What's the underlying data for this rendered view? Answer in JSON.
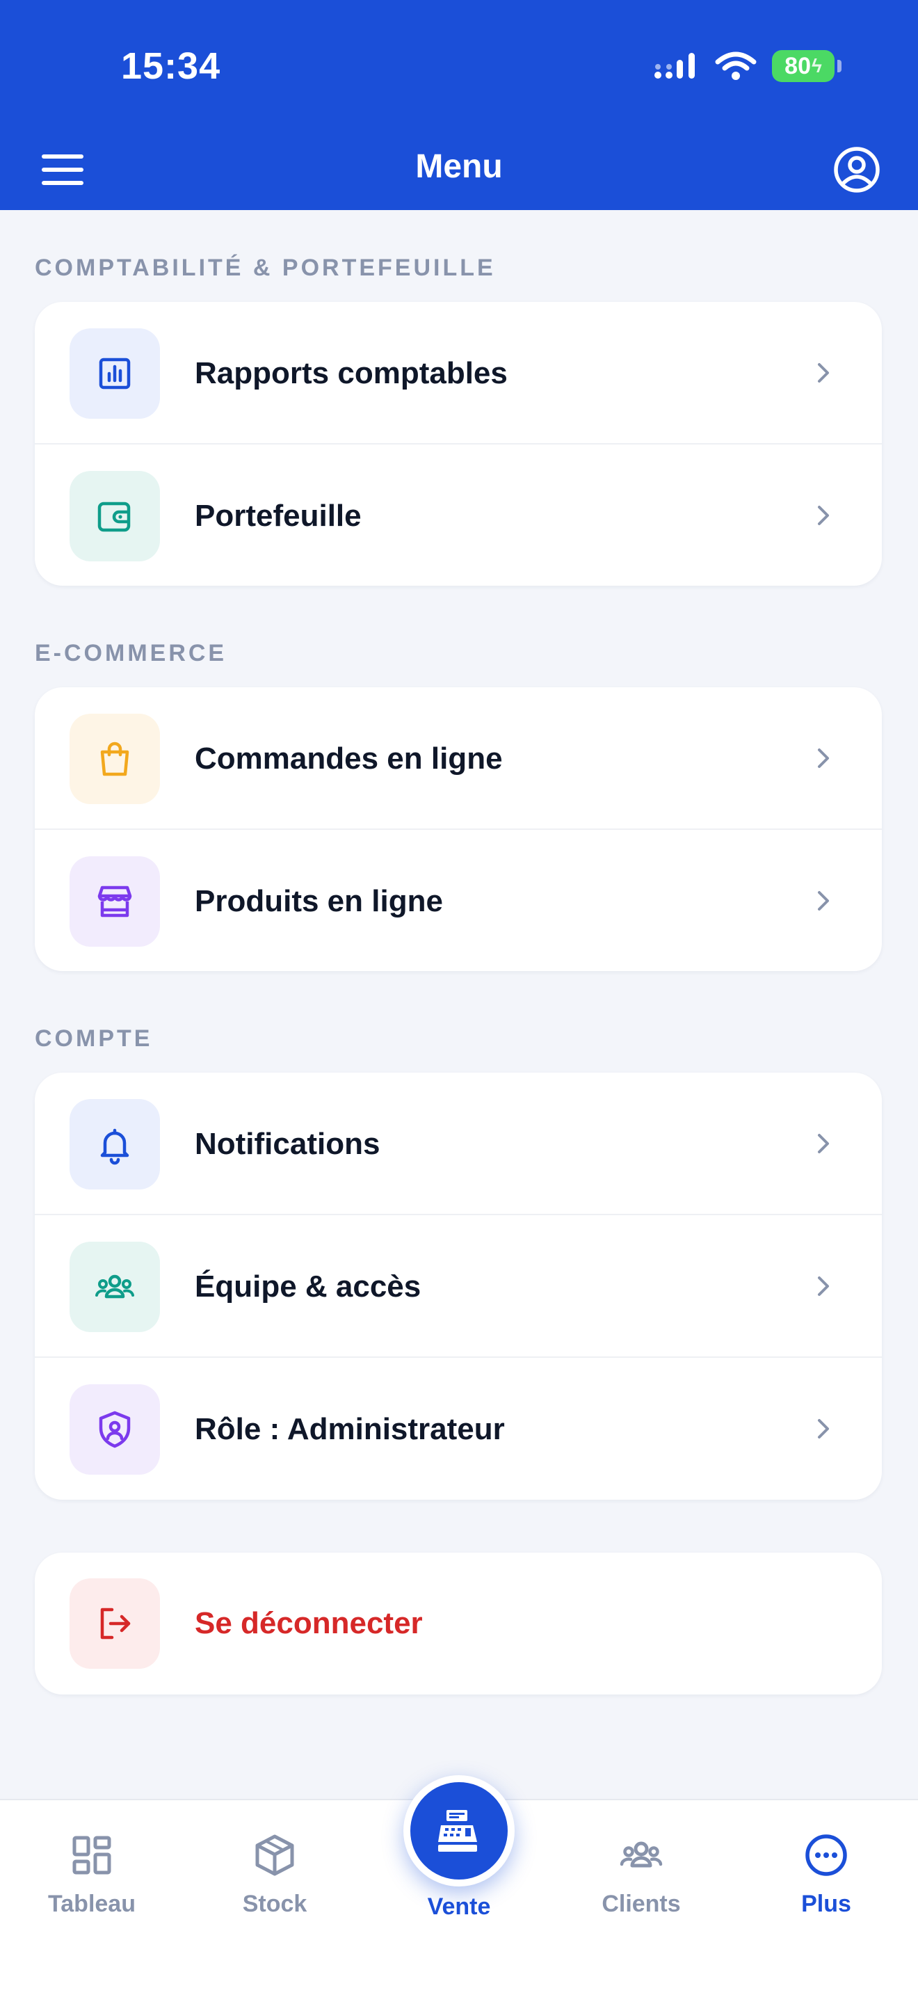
{
  "status_bar": {
    "time": "15:34",
    "battery": "80"
  },
  "header": {
    "title": "Menu"
  },
  "sections": [
    {
      "label": "COMPTABILITÉ & PORTEFEUILLE",
      "items": [
        {
          "label": "Rapports comptables",
          "icon": "chart-report-icon"
        },
        {
          "label": "Portefeuille",
          "icon": "wallet-icon"
        }
      ]
    },
    {
      "label": "E-COMMERCE",
      "items": [
        {
          "label": "Commandes en ligne",
          "icon": "shopping-bag-icon"
        },
        {
          "label": "Produits en ligne",
          "icon": "storefront-icon"
        }
      ]
    },
    {
      "label": "COMPTE",
      "items": [
        {
          "label": "Notifications",
          "icon": "bell-icon"
        },
        {
          "label": "Équipe & accès",
          "icon": "team-icon"
        },
        {
          "label": "Rôle : Administrateur",
          "icon": "shield-user-icon"
        }
      ]
    }
  ],
  "logout": {
    "label": "Se déconnecter",
    "icon": "logout-icon"
  },
  "bottom_nav": {
    "items": [
      {
        "label": "Tableau",
        "icon": "dashboard-grid-icon"
      },
      {
        "label": "Stock",
        "icon": "box-icon"
      },
      {
        "label": "Vente",
        "icon": "cash-register-icon"
      },
      {
        "label": "Clients",
        "icon": "users-icon"
      },
      {
        "label": "Plus",
        "icon": "more-dots-icon"
      }
    ],
    "active": "Plus"
  },
  "colors": {
    "primary": "#1b4fd8",
    "danger": "#d62828",
    "muted": "#8893ab",
    "background": "#f3f5fa"
  }
}
